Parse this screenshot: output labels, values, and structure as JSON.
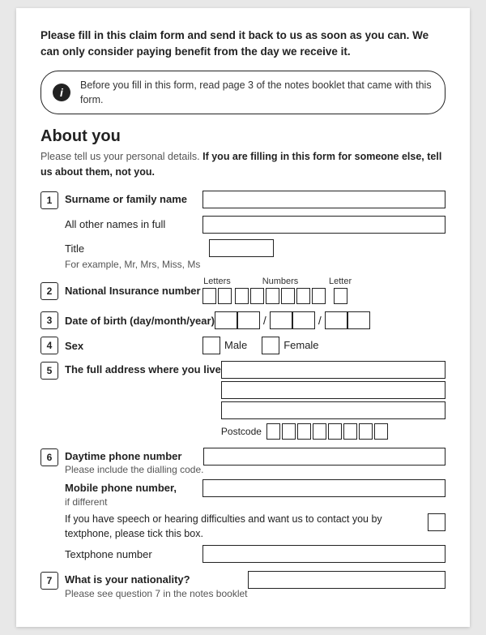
{
  "intro": {
    "text": "Please fill in this claim form and send it back to us as soon as you can. We can only consider paying benefit from the day we receive it."
  },
  "infoBox": {
    "icon": "i",
    "text": "Before you fill in this form, read page 3 of the notes booklet that came with this form."
  },
  "section": {
    "title": "About you",
    "subtitle_plain": "Please tell us your personal details. ",
    "subtitle_bold": "If you are filling in this form for someone else, tell us about them, not you."
  },
  "fields": {
    "q1_label": "Surname or family name",
    "q1_sublabel": "All other names in full",
    "q1_title_label": "Title",
    "q1_title_sub": "For example, Mr, Mrs, Miss, Ms",
    "q2_label": "National Insurance number",
    "q2_letters_label": "Letters",
    "q2_numbers_label": "Numbers",
    "q2_letter_label": "Letter",
    "q3_label": "Date of birth (day/month/year)",
    "q4_label": "Sex",
    "q4_male": "Male",
    "q4_female": "Female",
    "q5_label": "The full address where you live",
    "q5_postcode_label": "Postcode",
    "q6_label": "Daytime phone number",
    "q6_sub": "Please include the dialling code.",
    "q6_mobile_label": "Mobile phone number,",
    "q6_mobile_sub": "if different",
    "q6_textphone_text1": "If you have speech or hearing difficulties and want us to contact you by textphone, please tick this box.",
    "q6_textphone_label": "Textphone number",
    "q7_label": "What is your nationality?",
    "q7_note": "Please see question 7 in the notes booklet"
  },
  "steps": [
    "1",
    "2",
    "3",
    "4",
    "5",
    "6",
    "7"
  ]
}
